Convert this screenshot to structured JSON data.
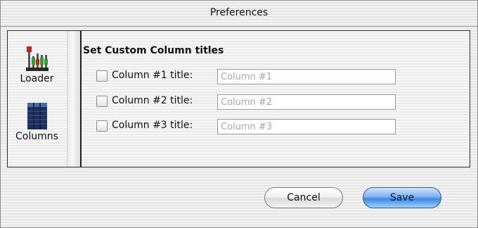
{
  "window": {
    "title": "Preferences"
  },
  "sidebar": {
    "items": [
      {
        "label": "Loader",
        "icon": "loader-icon"
      },
      {
        "label": "Columns",
        "icon": "columns-icon"
      }
    ]
  },
  "main": {
    "section_title": "Set Custom Column titles",
    "rows": [
      {
        "label": "Column #1 title:",
        "value": "",
        "placeholder": "Column #1",
        "checked": false
      },
      {
        "label": "Column #2 title:",
        "value": "",
        "placeholder": "Column #2",
        "checked": false
      },
      {
        "label": "Column #3 title:",
        "value": "",
        "placeholder": "Column #3",
        "checked": false
      }
    ]
  },
  "buttons": {
    "cancel_label": "Cancel",
    "save_label": "Save"
  },
  "colors": {
    "save_accent": "#3c87e0",
    "columns_icon_fill": "#2a3a6a"
  }
}
